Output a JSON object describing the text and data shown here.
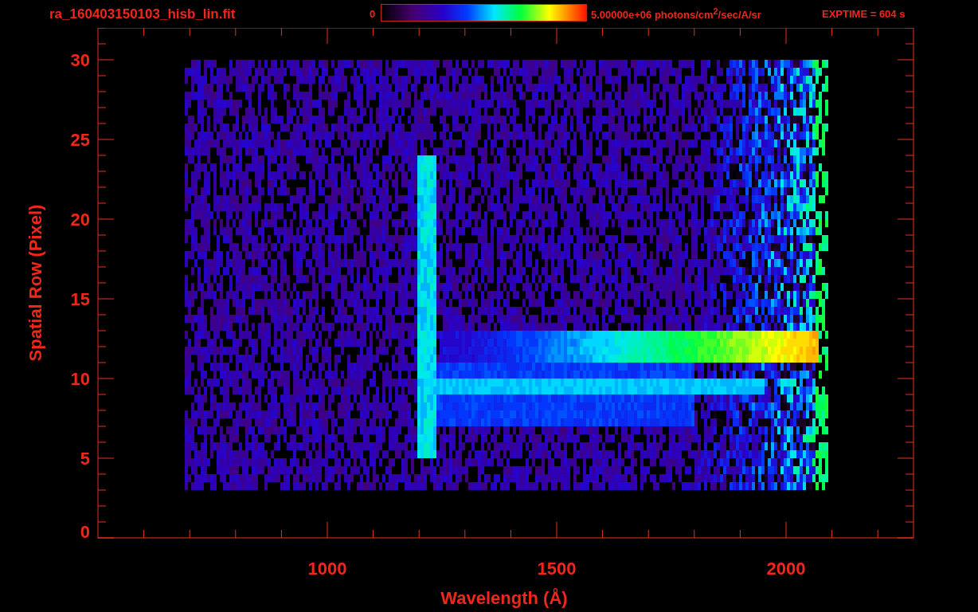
{
  "title": "ra_160403150103_hisb_lin.fit",
  "colorbar": {
    "min_label": "0",
    "max_label": "5.00000e+06 photons/cm$^{2}$/sec/A/sr"
  },
  "exposure": "EXPTIME = 604 s",
  "x_axis": {
    "label": "Wavelength (Å)",
    "ticks": [
      "1000",
      "1500",
      "2000"
    ]
  },
  "y_axis": {
    "label": "Spatial Row (Pixel)",
    "ticks": [
      "30",
      "25",
      "20",
      "15",
      "10",
      "5",
      "0"
    ]
  }
}
